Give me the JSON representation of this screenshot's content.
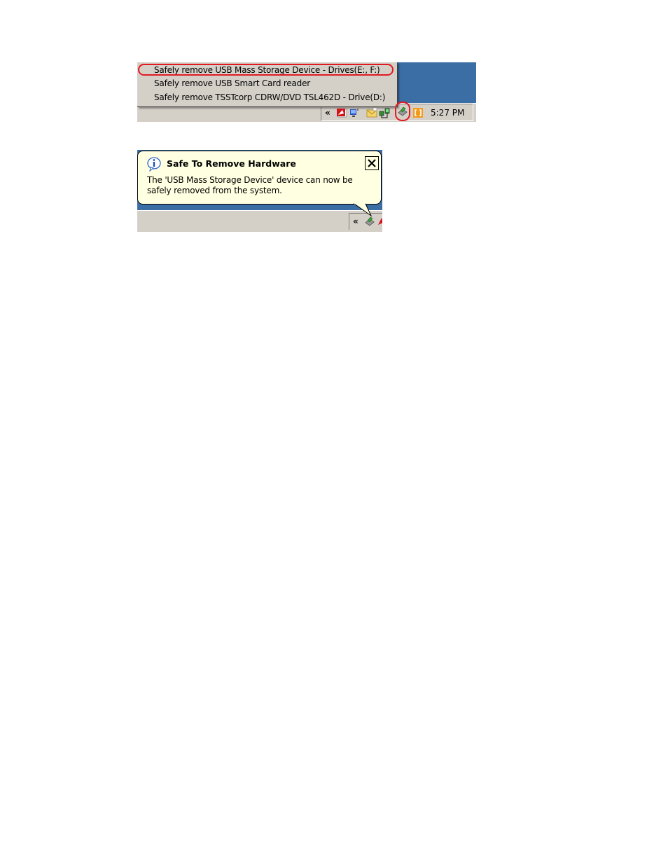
{
  "menu": {
    "items": [
      {
        "label": "Safely remove USB Mass Storage Device - Drives(E:, F:)",
        "highlighted": true
      },
      {
        "label": "Safely remove USB Smart Card reader",
        "highlighted": false
      },
      {
        "label": "Safely remove TSSTcorp CDRW/DVD TSL462D - Drive(D:)",
        "highlighted": false
      }
    ]
  },
  "taskbar": {
    "expand_glyph": "«",
    "clock": "5:27 PM",
    "tray_icons": [
      "acrobat-icon",
      "network-icon",
      "mail-icon",
      "connection-icon",
      "safely-remove-hardware-icon",
      "bracket-app-icon"
    ]
  },
  "balloon": {
    "title": "Safe To Remove Hardware",
    "message": "The 'USB Mass Storage Device' device can now be safely removed from the system.",
    "icon": "info-icon",
    "close_icon": "close-icon"
  },
  "taskbar2": {
    "expand_glyph": "«"
  },
  "colors": {
    "desktop_blue": "#3a6ea5",
    "taskbar_gray": "#d4d0c8",
    "balloon_yellow": "#ffffe1",
    "highlight_red": "#e21a23"
  }
}
